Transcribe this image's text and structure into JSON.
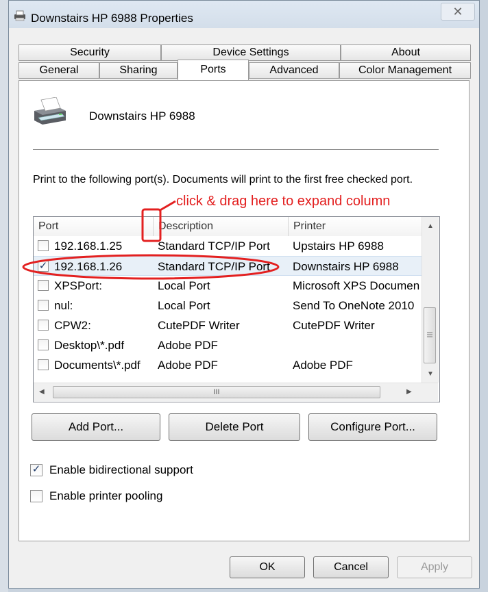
{
  "window": {
    "title": "Downstairs HP 6988 Properties",
    "close_glyph": "✕"
  },
  "tabs_row1": [
    "Security",
    "Device Settings",
    "About"
  ],
  "tabs_row2": [
    "General",
    "Sharing",
    "Ports",
    "Advanced",
    "Color Management"
  ],
  "active_tab": "Ports",
  "printer": {
    "name": "Downstairs HP 6988",
    "icon": "printer-icon"
  },
  "description": "Print to the following port(s). Documents will print to the first free checked port.",
  "annotation": {
    "text": "click & drag here to expand column",
    "color": "#e32020"
  },
  "columns": [
    "Port",
    "Description",
    "Printer"
  ],
  "ports": [
    {
      "port": "192.168.1.25",
      "description": "Standard TCP/IP Port",
      "printer": "Upstairs HP 6988",
      "checked": false
    },
    {
      "port": "192.168.1.26",
      "description": "Standard TCP/IP Port",
      "printer": "Downstairs HP 6988",
      "checked": true
    },
    {
      "port": "XPSPort:",
      "description": "Local Port",
      "printer": "Microsoft XPS Documen",
      "checked": false
    },
    {
      "port": "nul:",
      "description": "Local Port",
      "printer": "Send To OneNote 2010",
      "checked": false
    },
    {
      "port": "CPW2:",
      "description": "CutePDF Writer",
      "printer": "CutePDF Writer",
      "checked": false
    },
    {
      "port": "Desktop\\*.pdf",
      "description": "Adobe PDF",
      "printer": "",
      "checked": false
    },
    {
      "port": "Documents\\*.pdf",
      "description": "Adobe PDF",
      "printer": "Adobe PDF",
      "checked": false
    }
  ],
  "buttons": {
    "add_port": "Add Port...",
    "delete_port": "Delete Port",
    "configure_port": "Configure Port..."
  },
  "options": {
    "bidirectional": {
      "label": "Enable bidirectional support",
      "checked": true
    },
    "pooling": {
      "label": "Enable printer pooling",
      "checked": false
    }
  },
  "dialog_buttons": {
    "ok": "OK",
    "cancel": "Cancel",
    "apply": "Apply",
    "apply_disabled": true
  },
  "scroll_glyph": "III"
}
